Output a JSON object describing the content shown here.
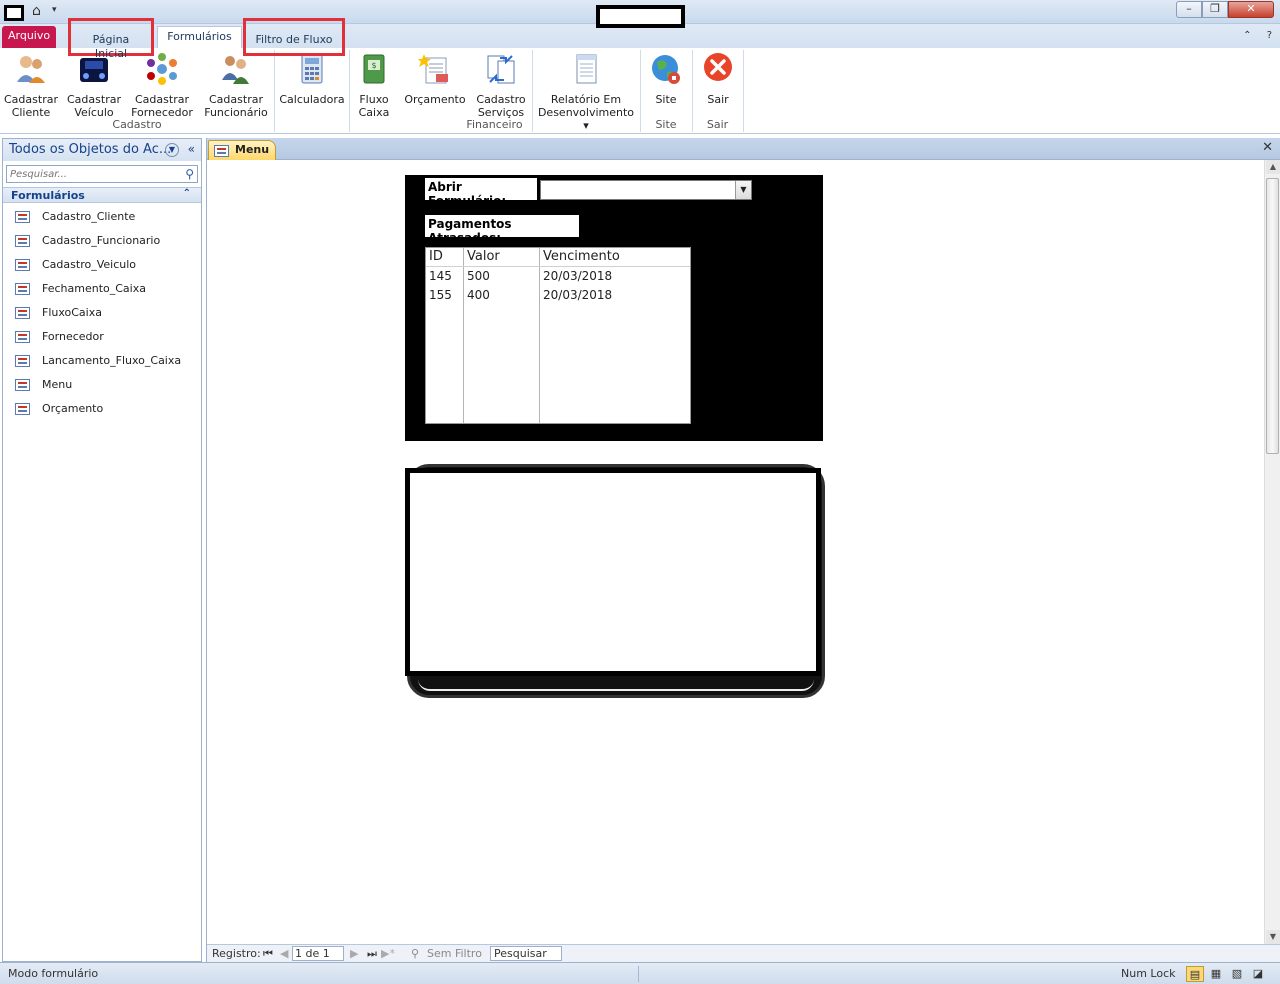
{
  "titlebar": {
    "minimize_glyph": "–",
    "maximize_glyph": "❐",
    "close_glyph": "✕"
  },
  "tabs": {
    "file": "Arquivo",
    "home": "Página Inicial",
    "forms": "Formulários",
    "flow_filter": "Filtro de Fluxo"
  },
  "ribbon": {
    "buttons": [
      {
        "line1": "Cadastrar",
        "line2": "Cliente",
        "icon": "users-icon"
      },
      {
        "line1": "Cadastrar",
        "line2": "Veículo",
        "icon": "car-icon"
      },
      {
        "line1": "Cadastrar",
        "line2": "Fornecedor",
        "icon": "network-icon"
      },
      {
        "line1": "Cadastrar",
        "line2": "Funcionário",
        "icon": "team-icon"
      },
      {
        "line1": "Calculadora",
        "line2": "",
        "icon": "calculator-icon"
      },
      {
        "line1": "Fluxo",
        "line2": "Caixa",
        "icon": "cashbook-icon"
      },
      {
        "line1": "Orçamento",
        "line2": "",
        "icon": "budget-icon"
      },
      {
        "line1": "Cadastro",
        "line2": "Serviços",
        "icon": "services-icon"
      },
      {
        "line1": "Relatório Em",
        "line2": "Desenvolvimento ▾",
        "icon": "report-icon"
      },
      {
        "line1": "Site",
        "line2": "",
        "icon": "globe-icon"
      },
      {
        "line1": "Sair",
        "line2": "",
        "icon": "exit-icon"
      }
    ],
    "groups": {
      "cadastro": "Cadastro",
      "financeiro": "Financeiro",
      "site": "Site",
      "sair": "Sair"
    }
  },
  "nav": {
    "header": "Todos os Objetos do Ac...",
    "search_placeholder": "Pesquisar...",
    "group": "Formulários",
    "items": [
      "Cadastro_Cliente",
      "Cadastro_Funcionario",
      "Cadastro_Veiculo",
      "Fechamento_Caixa",
      "FluxoCaixa",
      "Fornecedor",
      "Lancamento_Fluxo_Caixa",
      "Menu",
      "Orçamento"
    ]
  },
  "document": {
    "tab": "Menu",
    "open_form_label": "Abrir Formulário:",
    "open_form_value": "",
    "late_payments_label": "Pagamentos Atrasados:",
    "late_table": {
      "columns": [
        "ID",
        "Valor",
        "Vencimento"
      ],
      "rows": [
        [
          "145",
          "500",
          "20/03/2018"
        ],
        [
          "155",
          "400",
          "20/03/2018"
        ]
      ]
    }
  },
  "record_nav": {
    "label": "Registro:",
    "position": "1 de 1",
    "filter": "Sem Filtro",
    "search": "Pesquisar"
  },
  "status": {
    "mode": "Modo formulário",
    "numlock": "Num Lock"
  },
  "colors": {
    "file_tab": "#c8174e",
    "highlight_border": "#e0303a",
    "active_doc_tab": "#ffd76a"
  }
}
